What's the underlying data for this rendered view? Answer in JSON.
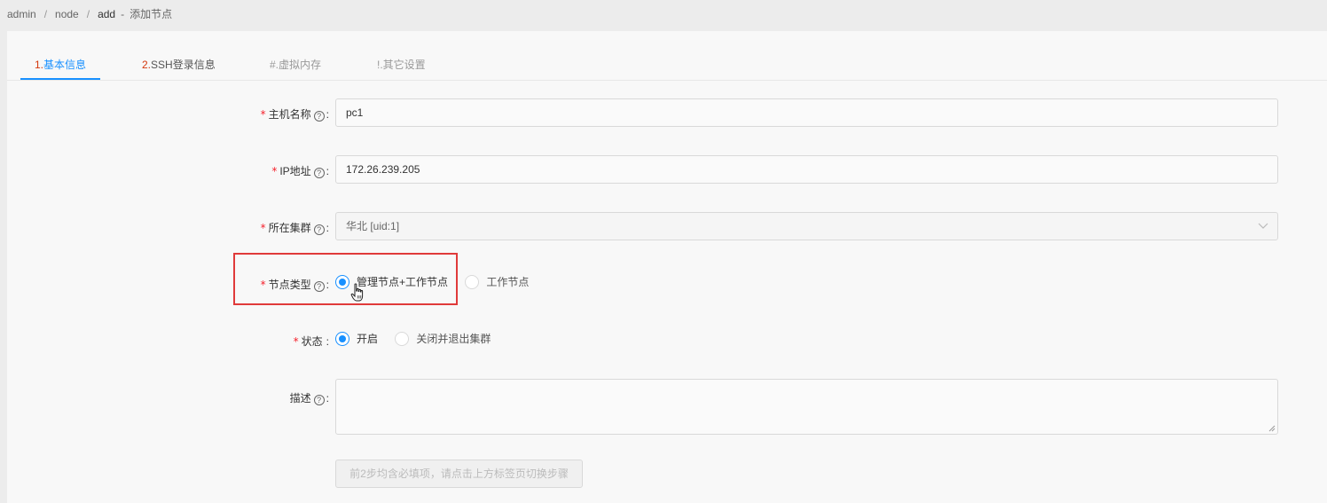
{
  "breadcrumb": {
    "items": [
      "admin",
      "node",
      "add"
    ],
    "separator": "/",
    "page_title": "添加节点"
  },
  "tabs": [
    {
      "num": "1.",
      "label": "基本信息",
      "active": true
    },
    {
      "num": "2.",
      "label": "SSH登录信息",
      "active": false
    },
    {
      "num": "#.",
      "label": "虚拟内存",
      "active": false
    },
    {
      "num": "!.",
      "label": "其它设置",
      "active": false
    }
  ],
  "form": {
    "hostname": {
      "label": "主机名称",
      "value": "pc1",
      "required": true
    },
    "ip": {
      "label": "IP地址",
      "value": "172.26.239.205",
      "required": true
    },
    "cluster": {
      "label": "所在集群",
      "value": "华北 [uid:1]",
      "required": true
    },
    "node_type": {
      "label": "节点类型",
      "required": true,
      "options": [
        "管理节点+工作节点",
        "工作节点"
      ],
      "selected": "管理节点+工作节点"
    },
    "status": {
      "label": "状态",
      "required": true,
      "options": [
        "开启",
        "关闭并退出集群"
      ],
      "selected": "开启"
    },
    "description": {
      "label": "描述",
      "value": ""
    },
    "submit_hint": "前2步均含必填项，请点击上方标签页切换步骤"
  },
  "colors": {
    "accent": "#1890ff",
    "required": "#f5222d",
    "highlight": "#e03a3a",
    "tab_number": "#d4380d"
  },
  "icons": {
    "help": "question-circle-icon",
    "select_arrow": "chevron-down-icon",
    "cursor": "hand-pointer-icon"
  }
}
